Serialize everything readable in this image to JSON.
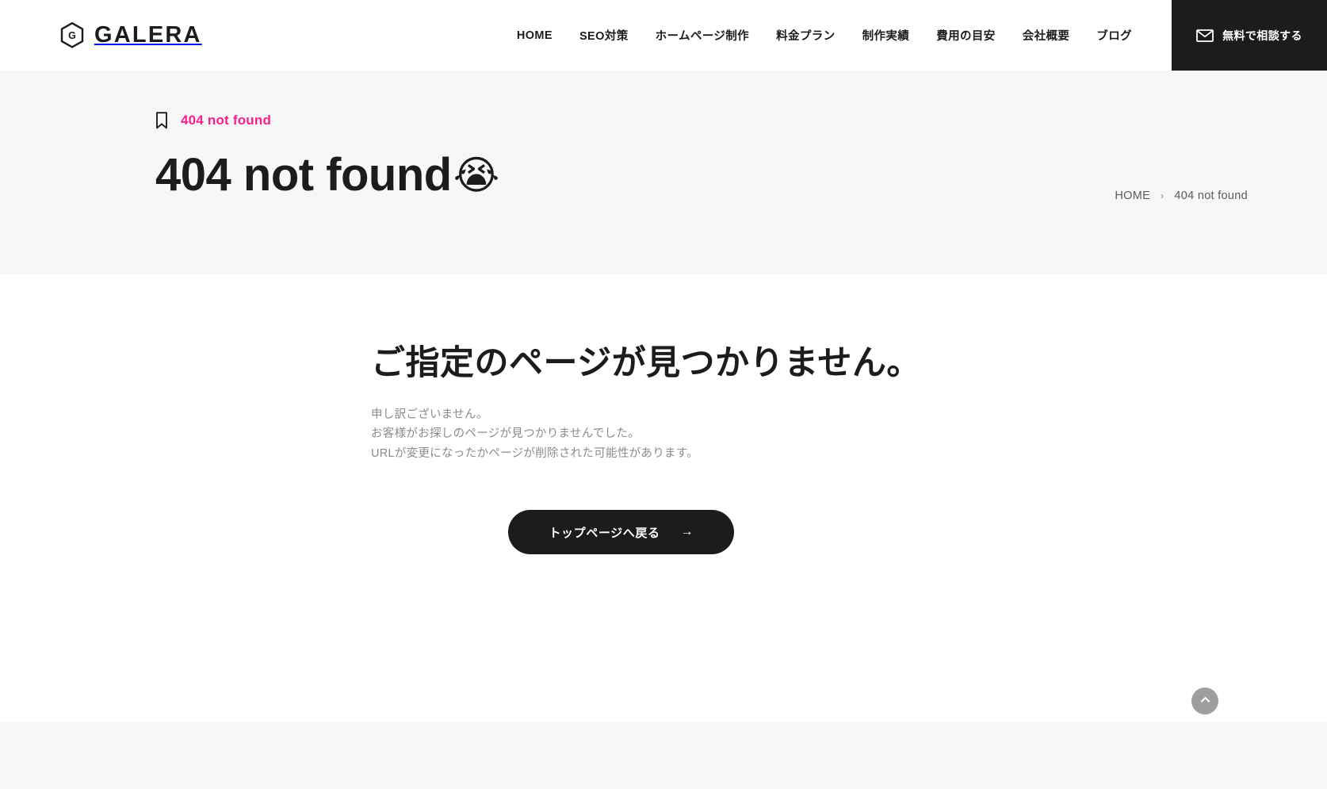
{
  "header": {
    "brand": {
      "name": "GALERA",
      "logo_icon": "hexagon-g-logo"
    },
    "nav": [
      {
        "label": "HOME"
      },
      {
        "label": "SEO対策"
      },
      {
        "label": "ホームページ制作"
      },
      {
        "label": "料金プラン"
      },
      {
        "label": "制作実績"
      },
      {
        "label": "費用の目安"
      },
      {
        "label": "会社概要"
      },
      {
        "label": "ブログ"
      }
    ],
    "cta": {
      "label": "無料で相談する",
      "icon": "mail-envelope-icon",
      "background": "#1c1c1c",
      "text_color": "#ffffff"
    }
  },
  "hero": {
    "label": {
      "text": "404 not found",
      "icon": "bookmark-icon",
      "color": "#f5208c"
    },
    "title": "404 not found",
    "emoji": "😭",
    "background": "#f7f7f7",
    "breadcrumb": {
      "home": "HOME",
      "separator": "›",
      "current": "404 not found"
    }
  },
  "main": {
    "heading": "ご指定のページが見つかりません。",
    "body_lines": [
      "申し訳ございません。",
      "お客様がお探しのページが見つかりませんでした。",
      "URLが変更になったかページが削除された可能性があります。"
    ],
    "button": {
      "label": "トップページへ戻る",
      "arrow": "→"
    }
  },
  "scroll_to_top": {
    "icon": "chevron-up-icon",
    "color": "#9e9e9e"
  },
  "colors": {
    "accent_pink": "#f5208c",
    "ink": "#1c1c1c",
    "muted": "#8b8b8b",
    "surface": "#f7f7f7"
  }
}
